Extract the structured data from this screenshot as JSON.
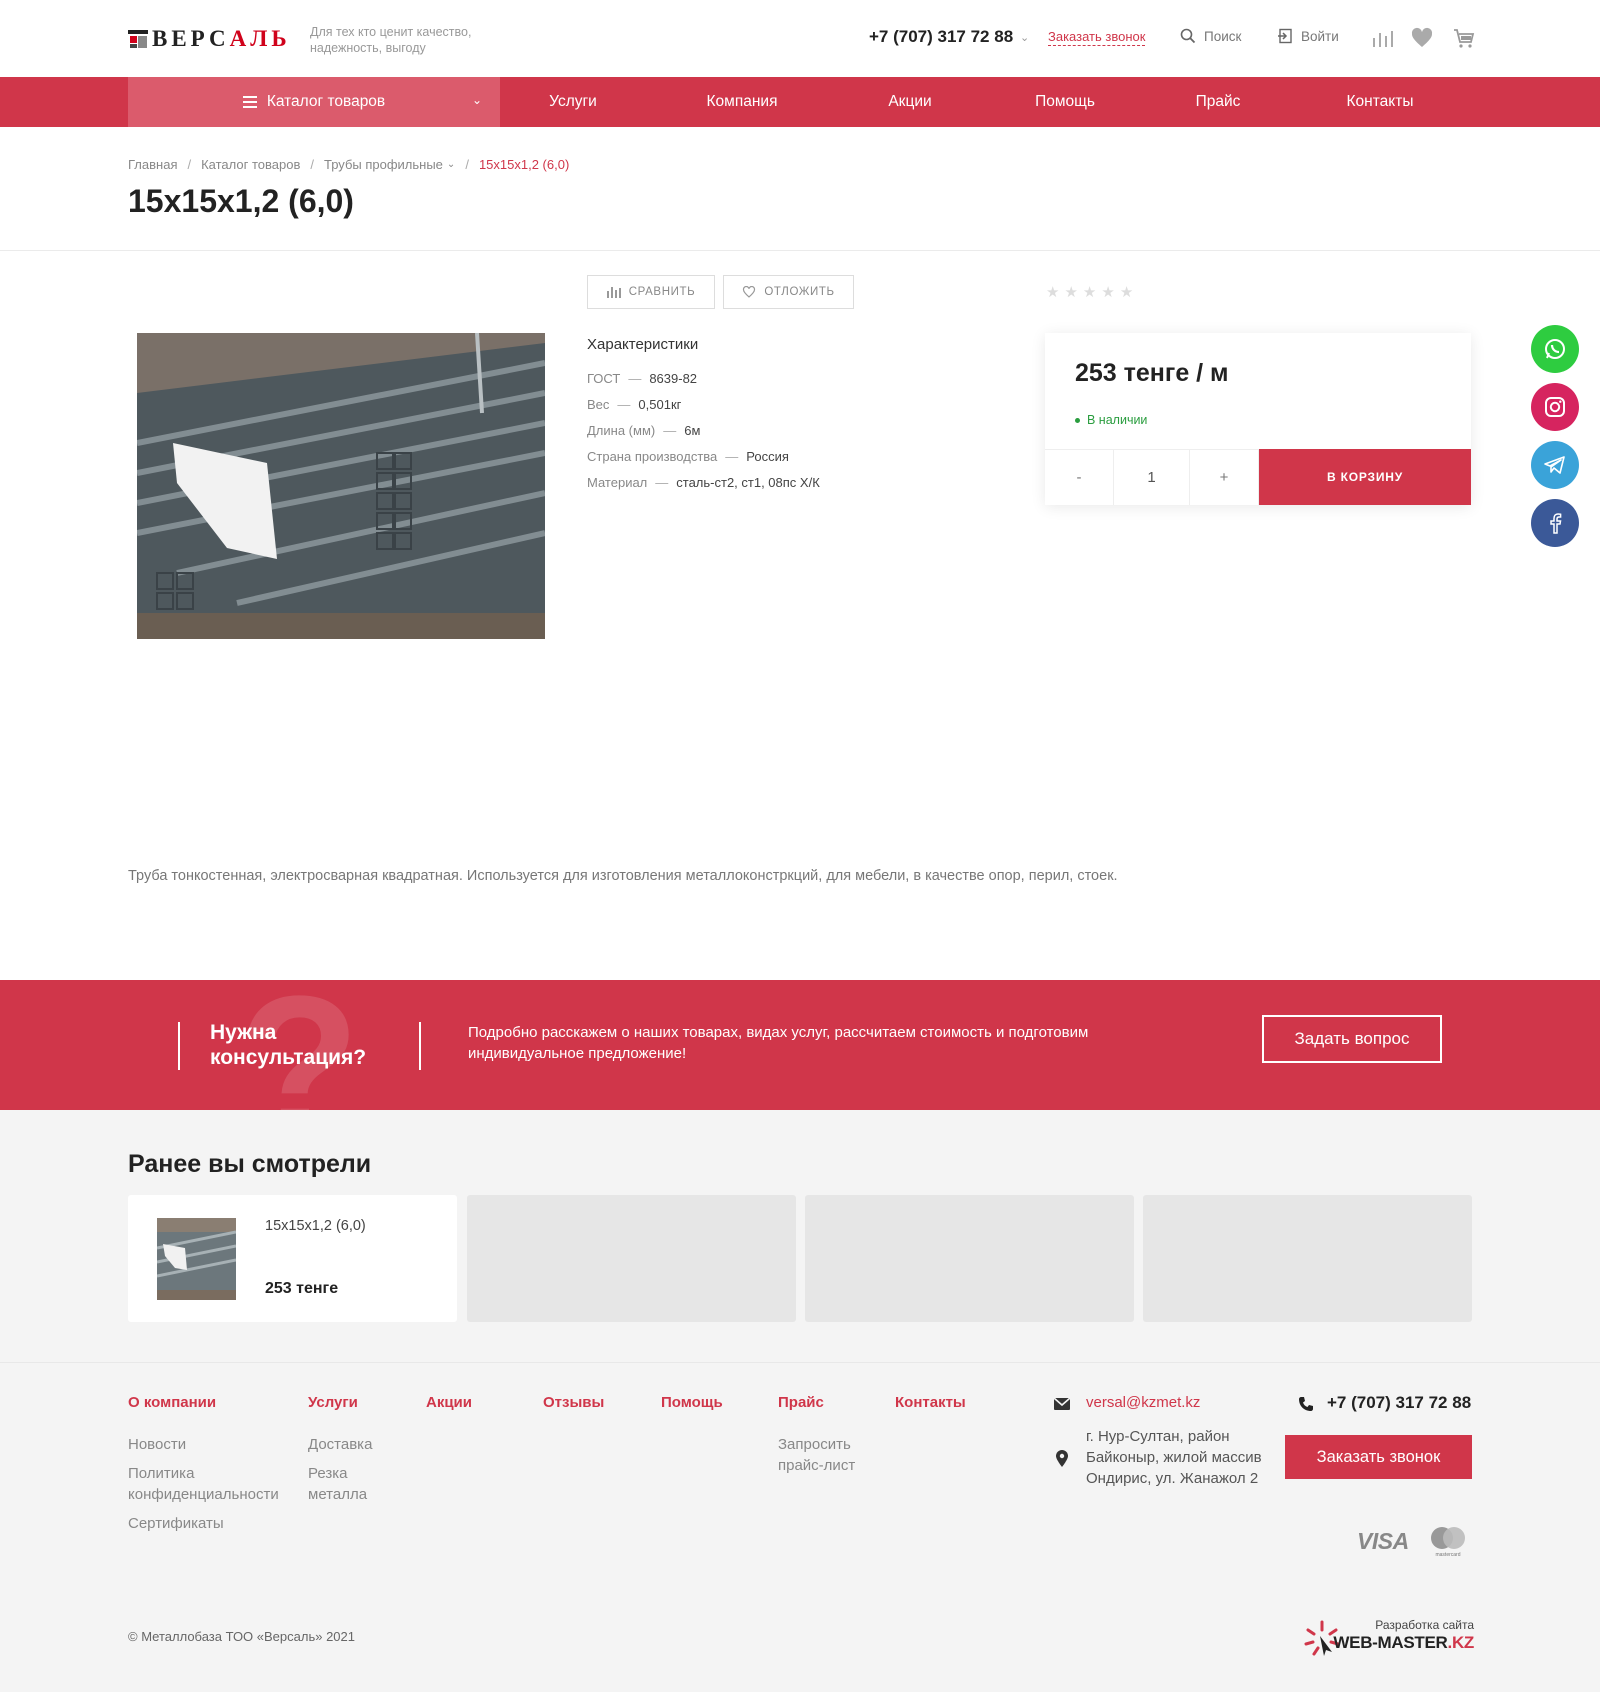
{
  "header": {
    "logo_prefix": "ВЕРС",
    "logo_suffix": "АЛЬ",
    "tagline": "Для тех кто ценит качество, надежность, выгоду",
    "phone": "+7 (707) 317 72 88",
    "call_link": "Заказать звонок",
    "search_label": "Поиск",
    "login_label": "Войти"
  },
  "nav": {
    "catalog": "Каталог товаров",
    "items": [
      "Услуги",
      "Компания",
      "Акции",
      "Помощь",
      "Прайс",
      "Контакты"
    ]
  },
  "breadcrumbs": [
    "Главная",
    "Каталог товаров",
    "Трубы профильные",
    "15x15x1,2 (6,0)"
  ],
  "product": {
    "title": "15x15x1,2 (6,0)",
    "compare_label": "СРАВНИТЬ",
    "defer_label": "ОТЛОЖИТЬ",
    "rating": 0,
    "characteristics_title": "Характеристики",
    "characteristics": [
      {
        "name": "ГОСТ",
        "value": "8639-82"
      },
      {
        "name": "Вес",
        "value": "0,501кг"
      },
      {
        "name": "Длина (мм)",
        "value": "6м"
      },
      {
        "name": "Страна производства",
        "value": "Россия"
      },
      {
        "name": "Материал",
        "value": "сталь-ст2, ст1, 08пс Х/К"
      }
    ],
    "price": "253 тенге / м",
    "stock": "В наличии",
    "qty_minus": "-",
    "qty_value": "1",
    "qty_plus": "+",
    "to_cart": "В КОРЗИНУ",
    "description": "Труба тонкостенная, электросварная квадратная. Используется  для  изготовления металлоконстркций, для мебели, в качестве  опор, перил,  стоек."
  },
  "social": [
    {
      "name": "whatsapp",
      "color": "#2ecc40"
    },
    {
      "name": "instagram",
      "color": "#d6245f"
    },
    {
      "name": "telegram",
      "color": "#3aa3d9"
    },
    {
      "name": "facebook",
      "color": "#3b5998"
    }
  ],
  "consult": {
    "title": "Нужна консультация?",
    "text": "Подробно расскажем о наших товарах, видах услуг, рассчитаем стоимость и подготовим индивидуальное предложение!",
    "button": "Задать вопрос"
  },
  "viewed": {
    "title": "Ранее вы смотрели",
    "items": [
      {
        "name": "15x15x1,2 (6,0)",
        "price": "253 тенге"
      }
    ]
  },
  "footer": {
    "columns": [
      {
        "title": "О компании",
        "links": [
          "Новости",
          "Политика конфиденциальности",
          "Сертификаты"
        ]
      },
      {
        "title": "Услуги",
        "links": [
          "Доставка",
          "Резка металла"
        ]
      },
      {
        "title": "Акции",
        "links": []
      },
      {
        "title": "Отзывы",
        "links": []
      },
      {
        "title": "Помощь",
        "links": []
      },
      {
        "title": "Прайс",
        "links": [
          "Запросить прайс-лист"
        ]
      },
      {
        "title": "Контакты",
        "links": []
      }
    ],
    "email": "versal@kzmet.kz",
    "address": "г. Нур-Султан, район Байконыр, жилой массив Ондирис, ул. Жанажол 2",
    "phone": "+7 (707) 317 72 88",
    "call_button": "Заказать звонок",
    "visa": "VISA",
    "mastercard": "mastercard",
    "copyright": "© Металлобаза ТОО «Версаль» 2021",
    "dev_label": "Разработка сайта",
    "dev_brand": "WEB-MASTER",
    "dev_tld": ".KZ"
  }
}
